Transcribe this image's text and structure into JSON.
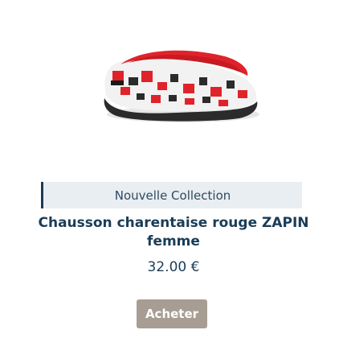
{
  "product": {
    "image_alt": "slipper-photo",
    "badge": "Nouvelle Collection",
    "title": "Chausson charentaise rouge ZAPIN femme",
    "price": "32.00 €",
    "buy_label": "Acheter"
  },
  "colors": {
    "badge_bg": "#e9eef3",
    "badge_border": "#1d3c55",
    "title": "#1a3d57",
    "button_bg": "#a79d92",
    "slipper_red": "#e0232b",
    "sole": "#2b2b2b"
  }
}
